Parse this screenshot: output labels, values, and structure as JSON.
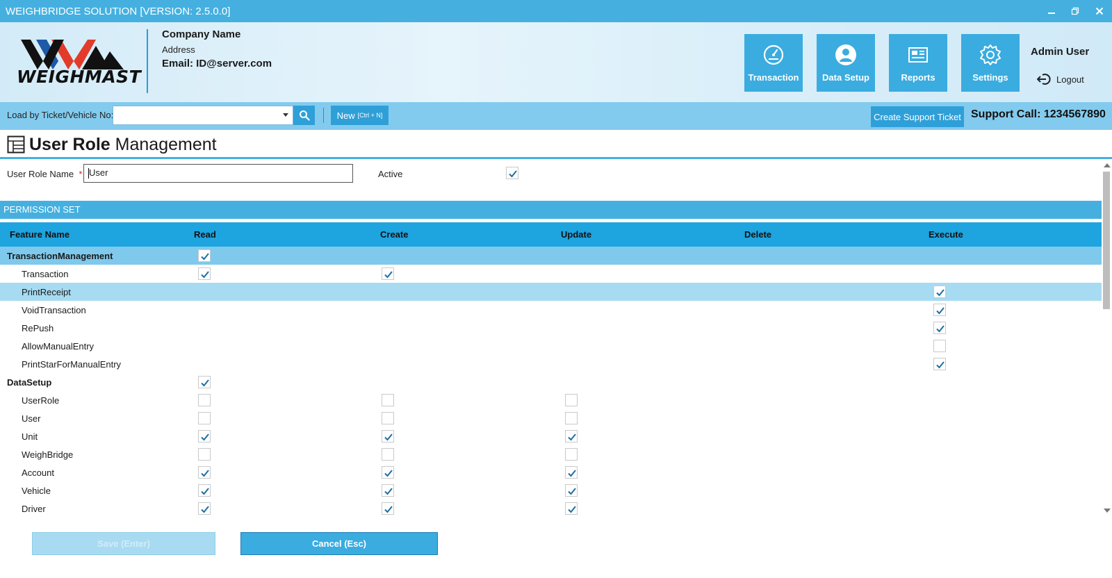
{
  "window": {
    "title": "WEIGHBRIDGE SOLUTION [VERSION: 2.5.0.0]",
    "controls": [
      "minimize-icon",
      "restore-icon",
      "close-icon"
    ]
  },
  "header": {
    "logo_text": "WEIGHMAST",
    "company_name": "Company Name",
    "address": "Address",
    "email": "Email: ID@server.com",
    "nav": [
      {
        "label": "Transaction",
        "icon": "speedometer-icon"
      },
      {
        "label": "Data Setup",
        "icon": "user-circle-icon"
      },
      {
        "label": "Reports",
        "icon": "report-icon"
      },
      {
        "label": "Settings",
        "icon": "gear-icon"
      }
    ],
    "user": "Admin User",
    "logout": "Logout"
  },
  "toolbar": {
    "load_label": "Load by Ticket/Vehicle No:",
    "load_value": "",
    "new_label": "New",
    "new_shortcut": "[Ctrl + N]",
    "support_button": "Create Support Ticket",
    "support_call": "Support Call: 1234567890"
  },
  "page": {
    "title_bold": "User Role",
    "title_rest": " Management"
  },
  "form": {
    "role_name_label": "User Role Name",
    "required_mark": "*",
    "role_name_value": "User",
    "active_label": "Active",
    "active_checked": true
  },
  "permissions": {
    "section_title": "PERMISSION SET",
    "columns": [
      "Feature Name",
      "Read",
      "Create",
      "Update",
      "Delete",
      "Execute"
    ],
    "rows": [
      {
        "name": "TransactionManagement",
        "group": true,
        "cells": [
          true,
          null,
          null,
          null,
          null
        ]
      },
      {
        "name": "Transaction",
        "group": false,
        "cells": [
          true,
          true,
          null,
          null,
          null
        ]
      },
      {
        "name": "PrintReceipt",
        "group": false,
        "cells": [
          null,
          null,
          null,
          null,
          true
        ]
      },
      {
        "name": "VoidTransaction",
        "group": false,
        "cells": [
          null,
          null,
          null,
          null,
          true
        ]
      },
      {
        "name": "RePush",
        "group": false,
        "cells": [
          null,
          null,
          null,
          null,
          true
        ]
      },
      {
        "name": "AllowManualEntry",
        "group": false,
        "cells": [
          null,
          null,
          null,
          null,
          false
        ]
      },
      {
        "name": "PrintStarForManualEntry",
        "group": false,
        "cells": [
          null,
          null,
          null,
          null,
          true
        ]
      },
      {
        "name": "DataSetup",
        "group": true,
        "cells": [
          true,
          null,
          null,
          null,
          null
        ]
      },
      {
        "name": "UserRole",
        "group": false,
        "cells": [
          false,
          false,
          false,
          null,
          null
        ]
      },
      {
        "name": "User",
        "group": false,
        "cells": [
          false,
          false,
          false,
          null,
          null
        ]
      },
      {
        "name": "Unit",
        "group": false,
        "cells": [
          true,
          true,
          true,
          null,
          null
        ]
      },
      {
        "name": "WeighBridge",
        "group": false,
        "cells": [
          false,
          false,
          false,
          null,
          null
        ]
      },
      {
        "name": "Account",
        "group": false,
        "cells": [
          true,
          true,
          true,
          null,
          null
        ]
      },
      {
        "name": "Vehicle",
        "group": false,
        "cells": [
          true,
          true,
          true,
          null,
          null
        ]
      },
      {
        "name": "Driver",
        "group": false,
        "cells": [
          true,
          true,
          true,
          null,
          null
        ]
      }
    ]
  },
  "buttons": {
    "save": "Save (Enter)",
    "cancel": "Cancel (Esc)"
  },
  "colors": {
    "accent": "#45b0e0",
    "grid_header": "#1ea4df",
    "row_highlight": "#a6dbf2",
    "check": "#1c6ea4"
  }
}
